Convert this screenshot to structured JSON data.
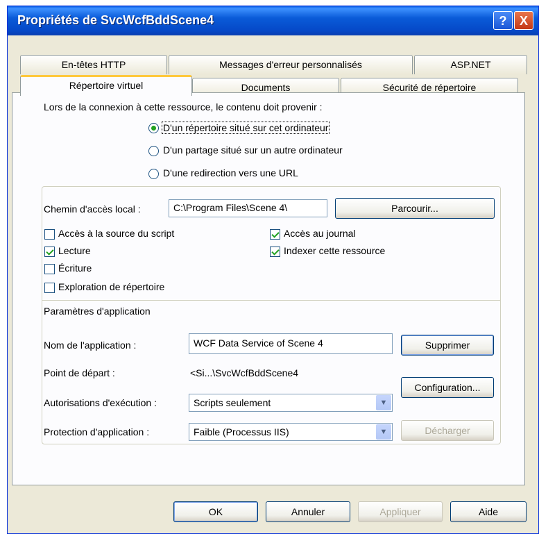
{
  "window": {
    "title": "Propriétés de SvcWcfBddScene4",
    "help": "?",
    "close": "X"
  },
  "tabs_back": [
    "En-têtes HTTP",
    "Messages d'erreur personnalisés",
    "ASP.NET"
  ],
  "tabs_front": [
    "Répertoire virtuel",
    "Documents",
    "Sécurité de répertoire"
  ],
  "content_source": {
    "label": "Lors de la connexion à cette ressource, le contenu doit provenir :",
    "options": [
      {
        "label": "D'un répertoire situé sur cet ordinateur",
        "selected": true
      },
      {
        "label": "D'un partage situé sur un autre ordinateur",
        "selected": false
      },
      {
        "label": "D'une redirection vers une URL",
        "selected": false
      }
    ]
  },
  "local_path": {
    "label": "Chemin d'accès local :",
    "value": "C:\\Program Files\\Scene 4\\",
    "browse": "Parcourir..."
  },
  "permissions": {
    "script_source": {
      "label": "Accès à la source du script",
      "checked": false
    },
    "read": {
      "label": "Lecture",
      "checked": true
    },
    "write": {
      "label": "Écriture",
      "checked": false
    },
    "browse": {
      "label": "Exploration de répertoire",
      "checked": false
    },
    "log": {
      "label": "Accès au journal",
      "checked": true
    },
    "index": {
      "label": "Indexer cette ressource",
      "checked": true
    }
  },
  "app_settings": {
    "heading": "Paramètres d'application",
    "name_label": "Nom de l'application :",
    "name_value": "WCF Data Service of Scene 4",
    "remove": "Supprimer",
    "start_label": "Point de départ :",
    "start_value": "<Si...\\SvcWcfBddScene4",
    "config": "Configuration...",
    "exec_label": "Autorisations d'exécution :",
    "exec_value": "Scripts seulement",
    "protect_label": "Protection d'application :",
    "protect_value": "Faible (Processus IIS)",
    "unload": "Décharger"
  },
  "footer": {
    "ok": "OK",
    "cancel": "Annuler",
    "apply": "Appliquer",
    "help": "Aide"
  },
  "colors": {
    "titlebar": "#0a5bd8",
    "face": "#ece9d8",
    "tab_highlight": "#ffc83c",
    "check": "#21a121"
  }
}
